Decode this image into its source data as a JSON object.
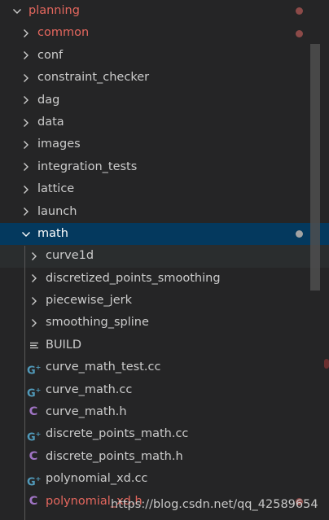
{
  "colors": {
    "modified_text": "#e4675e",
    "normal_text": "#cccccc",
    "selected_bg": "#04395e",
    "cpp_icon": "#519aba",
    "header_icon": "#a074c4",
    "modified_dot": "#8c4a48",
    "selected_dot": "#a3a3a3"
  },
  "tree": {
    "root": {
      "label": "planning",
      "expanded": true,
      "status": "modified"
    },
    "items": [
      {
        "label": "common",
        "type": "folder",
        "expanded": false,
        "status": "modified"
      },
      {
        "label": "conf",
        "type": "folder",
        "expanded": false
      },
      {
        "label": "constraint_checker",
        "type": "folder",
        "expanded": false
      },
      {
        "label": "dag",
        "type": "folder",
        "expanded": false
      },
      {
        "label": "data",
        "type": "folder",
        "expanded": false
      },
      {
        "label": "images",
        "type": "folder",
        "expanded": false
      },
      {
        "label": "integration_tests",
        "type": "folder",
        "expanded": false
      },
      {
        "label": "lattice",
        "type": "folder",
        "expanded": false
      },
      {
        "label": "launch",
        "type": "folder",
        "expanded": false
      },
      {
        "label": "math",
        "type": "folder",
        "expanded": true,
        "selected": true
      }
    ],
    "math_children": [
      {
        "label": "curve1d",
        "type": "folder",
        "icon": "chevron-right-icon"
      },
      {
        "label": "discretized_points_smoothing",
        "type": "folder",
        "icon": "chevron-right-icon"
      },
      {
        "label": "piecewise_jerk",
        "type": "folder",
        "icon": "chevron-right-icon"
      },
      {
        "label": "smoothing_spline",
        "type": "folder",
        "icon": "chevron-right-icon"
      },
      {
        "label": "BUILD",
        "type": "file",
        "icon": "lines-icon"
      },
      {
        "label": "curve_math_test.cc",
        "type": "file",
        "icon": "cpp-icon"
      },
      {
        "label": "curve_math.cc",
        "type": "file",
        "icon": "cpp-icon"
      },
      {
        "label": "curve_math.h",
        "type": "file",
        "icon": "c-header-icon"
      },
      {
        "label": "discrete_points_math.cc",
        "type": "file",
        "icon": "cpp-icon"
      },
      {
        "label": "discrete_points_math.h",
        "type": "file",
        "icon": "c-header-icon"
      },
      {
        "label": "polynomial_xd.cc",
        "type": "file",
        "icon": "cpp-icon"
      },
      {
        "label": "polynomial_xd.h",
        "type": "file",
        "icon": "c-header-icon",
        "status": "modified"
      }
    ]
  },
  "watermark": {
    "text": "https://blog.csdn.net/qq_42589654"
  }
}
